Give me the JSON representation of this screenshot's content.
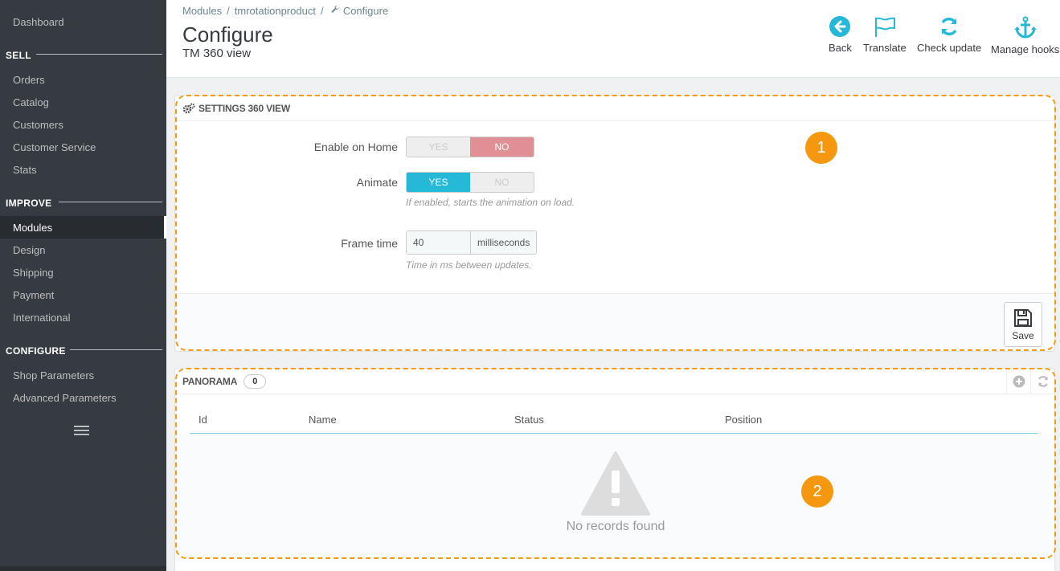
{
  "sidebar": {
    "dashboard": "Dashboard",
    "sections": [
      {
        "title": "SELL",
        "items": [
          "Orders",
          "Catalog",
          "Customers",
          "Customer Service",
          "Stats"
        ]
      },
      {
        "title": "IMPROVE",
        "items": [
          "Modules",
          "Design",
          "Shipping",
          "Payment",
          "International"
        ]
      },
      {
        "title": "CONFIGURE",
        "items": [
          "Shop Parameters",
          "Advanced Parameters"
        ]
      }
    ],
    "active_item": "Modules"
  },
  "header": {
    "breadcrumb": [
      "Modules",
      "tmrotationproduct",
      "Configure"
    ],
    "title": "Configure",
    "subtitle": "TM 360 view",
    "toolbar": {
      "back": "Back",
      "translate": "Translate",
      "check_update": "Check update",
      "manage_hooks": "Manage hooks"
    },
    "accent_color": "#25b9d7"
  },
  "settings_panel": {
    "title": "SETTINGS 360 VIEW",
    "callout_number": "1",
    "enable_home": {
      "label": "Enable on Home",
      "yes": "YES",
      "no": "NO",
      "value": "NO"
    },
    "animate": {
      "label": "Animate",
      "yes": "YES",
      "no": "NO",
      "value": "YES",
      "help": "If enabled, starts the animation on load."
    },
    "frame_time": {
      "label": "Frame time",
      "value": "40",
      "unit": "milliseconds",
      "help": "Time in ms between updates."
    },
    "save_label": "Save"
  },
  "panorama_panel": {
    "title": "PANORAMA",
    "count": "0",
    "callout_number": "2",
    "columns": [
      "Id",
      "Name",
      "Status",
      "Position"
    ],
    "empty_message": "No records found"
  }
}
